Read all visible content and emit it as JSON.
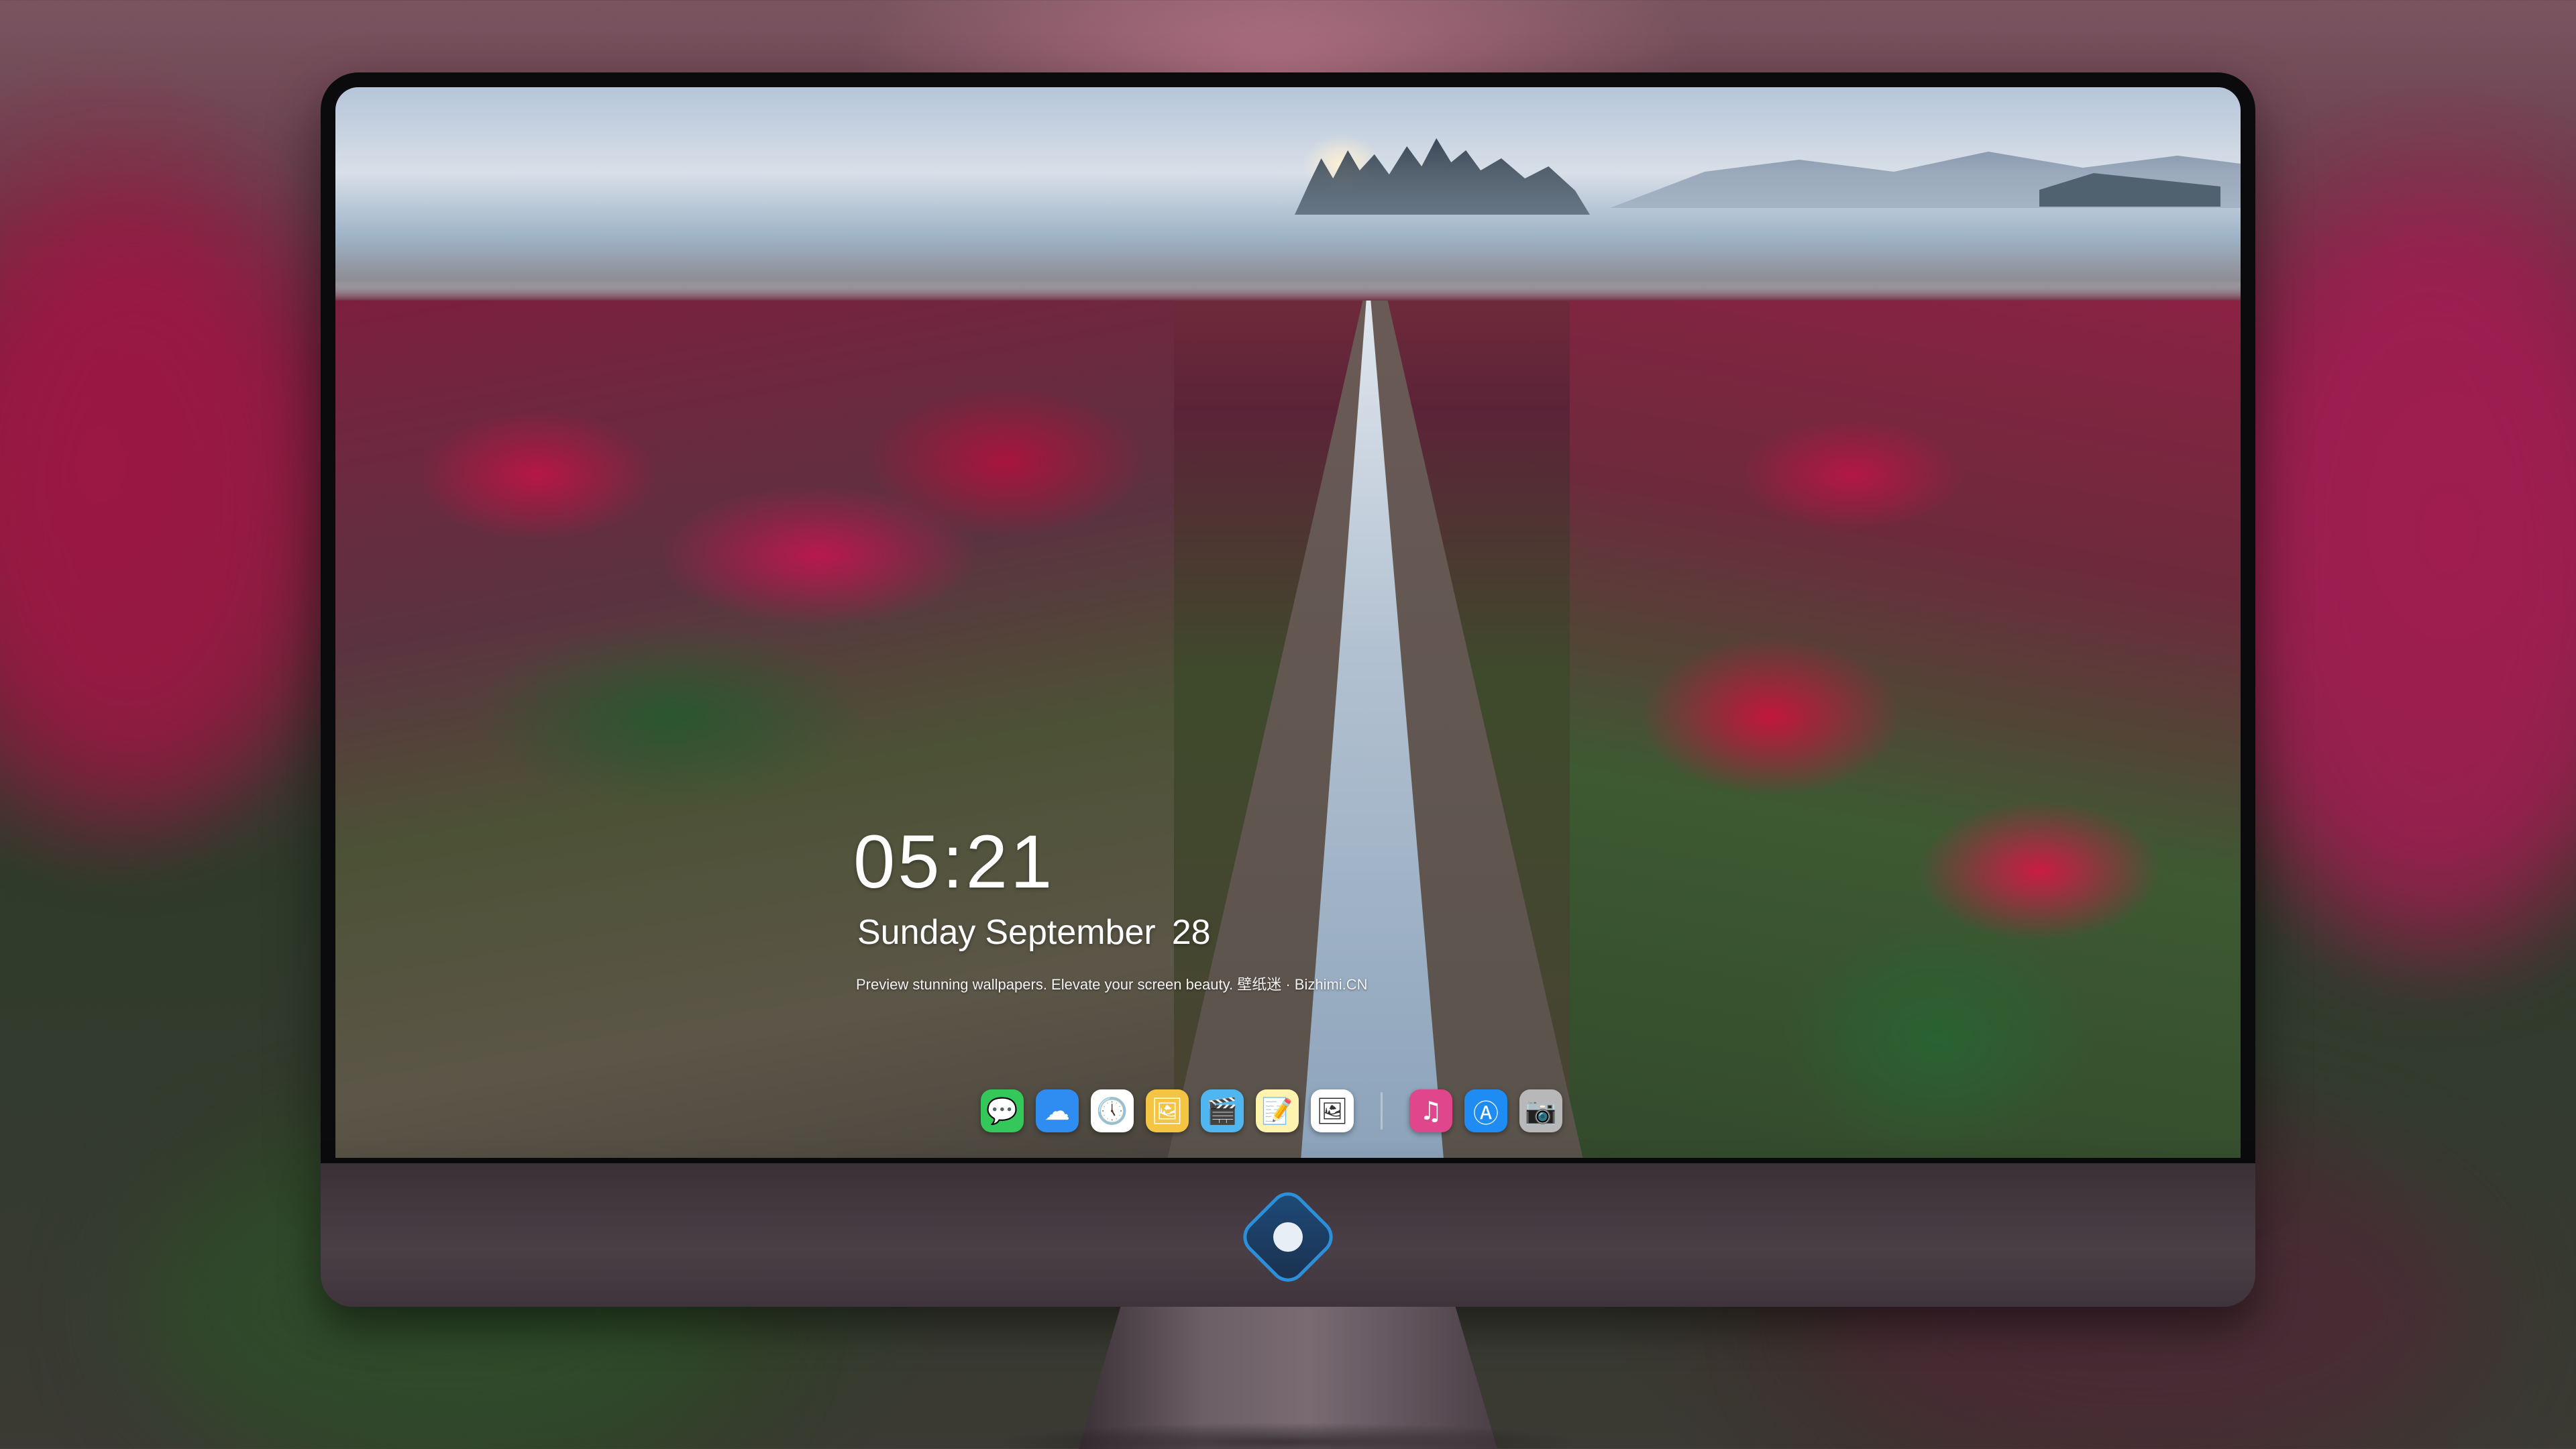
{
  "lockscreen": {
    "time": "05:21",
    "date": {
      "weekday": "Sunday",
      "month": "September",
      "day": "28"
    },
    "tagline": "Preview stunning wallpapers. Elevate your screen beauty. 壁纸迷 · Bizhimi.CN"
  },
  "dock": {
    "apps": [
      {
        "name": "messages-icon",
        "glyph": "💬",
        "color": "#34c759"
      },
      {
        "name": "weather-icon",
        "glyph": "☁",
        "color": "#2f8cf0"
      },
      {
        "name": "clock-icon",
        "glyph": "🕔",
        "color": "#ffffff"
      },
      {
        "name": "preview-icon",
        "glyph": "🖼",
        "color": "#f4c542"
      },
      {
        "name": "videos-icon",
        "glyph": "🎬",
        "color": "#4fb6f0"
      },
      {
        "name": "notes-icon",
        "glyph": "📝",
        "color": "#fff3b0"
      },
      {
        "name": "photos-icon",
        "glyph": "🖼",
        "color": "#ffffff"
      }
    ],
    "apps_right": [
      {
        "name": "music-icon",
        "glyph": "♫",
        "color": "#e0468c"
      },
      {
        "name": "app-store-icon",
        "glyph": "Ⓐ",
        "color": "#1e8cf3"
      },
      {
        "name": "camera-icon",
        "glyph": "📷",
        "color": "#b8b8b8"
      }
    ]
  },
  "colors": {
    "bezel": "#0b0b0d",
    "chin": "#4b3f46",
    "accent": "#2b90d9"
  }
}
